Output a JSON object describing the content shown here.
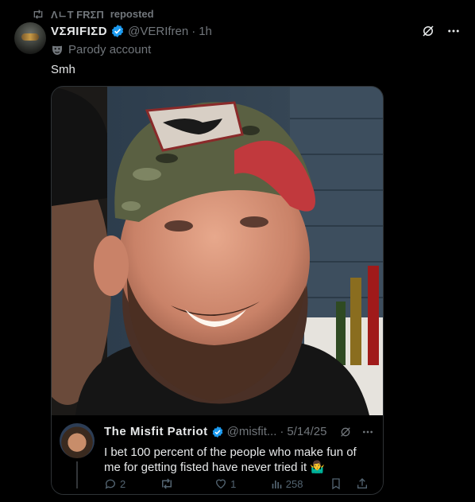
{
  "repost": {
    "user": "ΛㄴT FRΣΠ",
    "suffix": "reposted"
  },
  "post": {
    "display_name": "VΣЯIFIΣD",
    "handle": "@VERIfren",
    "separator": "·",
    "time": "1h",
    "label": "Parody account",
    "text": "Smh"
  },
  "quoted": {
    "display_name": "The Misfit Patriot",
    "handle": "@misfit...",
    "separator": "·",
    "date": "5/14/25",
    "text": "I bet 100 percent of the people who make fun of me for getting fisted have never tried it 🤷‍♂️",
    "actions": {
      "replies": "2",
      "reposts": "",
      "likes": "1",
      "views": "258"
    }
  },
  "colors": {
    "background": "#000000",
    "text": "#e7e9ea",
    "muted": "#71767b",
    "verified": "#1d9bf0"
  }
}
